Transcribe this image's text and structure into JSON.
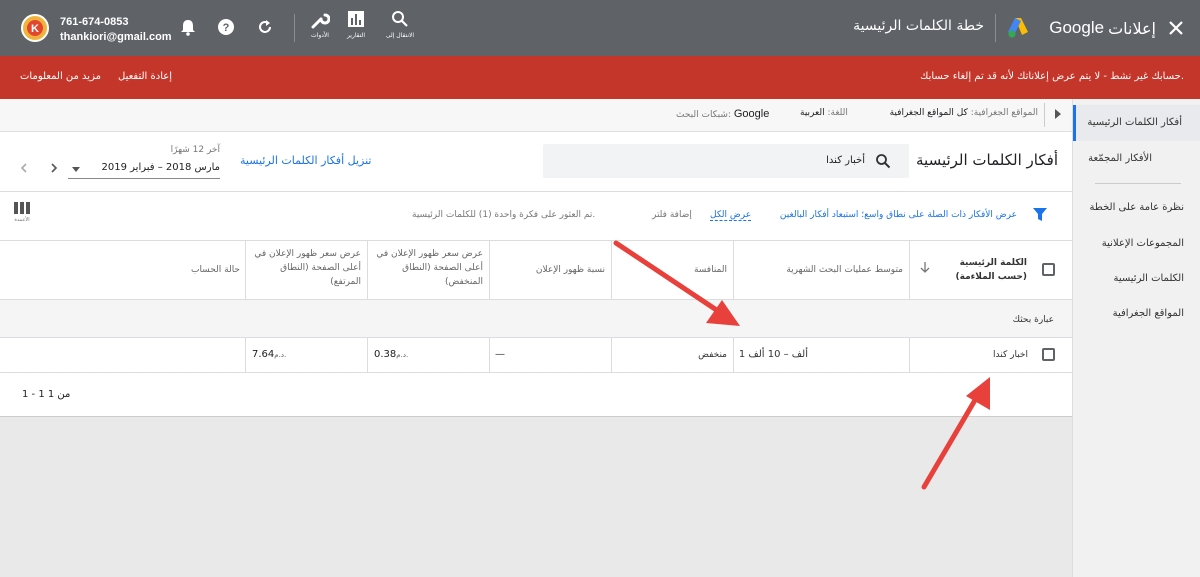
{
  "topbar": {
    "product_name": "Google",
    "product_sub": "إعلانات",
    "page_title": "خطة الكلمات الرئيسية",
    "phone": "761-674-0853",
    "email": "thankiori@gmail.com",
    "nav": [
      {
        "label": "الانتقال إلى",
        "icon": "search-icon"
      },
      {
        "label": "التقارير",
        "icon": "bar-chart-icon"
      },
      {
        "label": "الأدوات",
        "icon": "wrench-icon"
      }
    ]
  },
  "alert": {
    "message": "حسابك غير نشط - لا يتم عرض إعلاناتك لأنه قد تم إلغاء حسابك.",
    "reactivate": "إعادة التفعيل",
    "learn_more": "مزيد من المعلومات"
  },
  "targeting": {
    "locations_label": "المواقع الجغرافية:",
    "locations_value": "كل المواقع الجغرافية",
    "language_label": "اللغة:",
    "language_value": "العربية",
    "networks_label": "شبكات البحث:",
    "networks_value": "Google"
  },
  "sidebar": {
    "items": [
      {
        "label": "أفكار الكلمات الرئيسية",
        "active": true
      },
      {
        "label": "الأفكار المجمّعة"
      },
      {
        "label": "نظرة عامة على الخطة"
      },
      {
        "label": "المجموعات الإعلانية"
      },
      {
        "label": "الكلمات الرئيسية"
      },
      {
        "label": "المواقع الجغرافية"
      }
    ]
  },
  "header": {
    "title": "أفكار الكلمات الرئيسية",
    "search_value": "أخبار كندا",
    "download_label": "تنزيل أفكار الكلمات الرئيسية",
    "period_label": "آخر 12 شهرًا",
    "period_value": "مارس 2018 – فبراير 2019"
  },
  "filters": {
    "broad_match": "عرض الأفكار ذات الصلة على نطاق واسع؛ استبعاد أفكار البالغين",
    "show_all": "عرض الكل",
    "add_filter": "إضافة فلتر",
    "found_text": "تم العثور على فكرة واحدة (1) للكلمات الرئيسية.",
    "columns_label": "الأعمدة"
  },
  "table": {
    "headers": {
      "keyword": "الكلمة الرئيسية (حسب الملاءمة)",
      "avg_searches": "متوسط عمليات البحث الشهرية",
      "competition": "المنافسة",
      "impr_share": "نسبة ظهور الإعلان",
      "bid_low": "عرض سعر ظهور الإعلان في أعلى الصفحة (النطاق المنخفض)",
      "bid_high": "عرض سعر ظهور الإعلان في أعلى الصفحة (النطاق المرتفع)",
      "account_status": "حالة الحساب"
    },
    "group_label": "عبارة بحثك",
    "rows": [
      {
        "keyword": "اخبار كندا",
        "avg_searches": "1 ألف – 10 ألف",
        "competition": "منخفض",
        "impr_share": "—",
        "bid_low": "0.38",
        "bid_high": "7.64",
        "currency": "د.م.",
        "account_status": ""
      }
    ],
    "pagination": "1 - 1 من 1"
  },
  "colors": {
    "topbar": "#5f6368",
    "alert": "#c5362a",
    "accent": "#1a73e8",
    "arrow": "#e8413b"
  }
}
